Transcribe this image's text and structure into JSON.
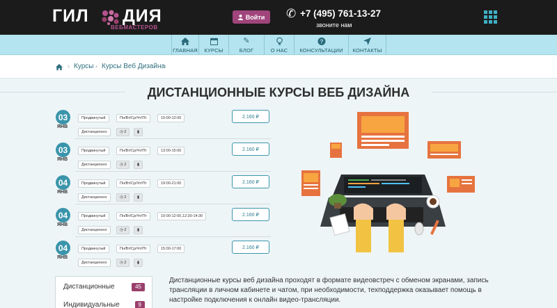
{
  "header": {
    "logo_left": "ГИЛ",
    "logo_right": "ДИЯ",
    "logo_sub": "ВЕБМАСТЕРОВ",
    "login_label": "Войти",
    "phone": "+7 (495) 761-13-27",
    "phone_note": "звоните нам"
  },
  "nav": [
    {
      "label": "ГЛАВНАЯ",
      "icon": "home-icon"
    },
    {
      "label": "КУРСЫ",
      "icon": "calendar-icon"
    },
    {
      "label": "БЛОГ",
      "icon": "pencil-icon"
    },
    {
      "label": "О НАС",
      "icon": "lightbulb-icon"
    },
    {
      "label": "КОНСУЛЬТАЦИИ",
      "icon": "question-icon"
    },
    {
      "label": "КОНТАКТЫ",
      "icon": "location-arrow-icon"
    }
  ],
  "breadcrumb": [
    "Курсы",
    "Курсы Веб Дизайна"
  ],
  "page_title": "ДИСТАНЦИОННЫЕ КУРСЫ ВЕБ ДИЗАЙНА",
  "courses": [
    {
      "day": "03",
      "month": "ЯНВ",
      "level": "Продвинутый",
      "days": "Пн/Вт/Ср/Чт/Пт",
      "time": "10:00-12:00",
      "format": "Дистанционно",
      "students": "2",
      "price": "2.160 ₽"
    },
    {
      "day": "03",
      "month": "ЯНВ",
      "level": "Продвинутый",
      "days": "Пн/Вт/Ср/Чт/Пт",
      "time": "13:00-15:00",
      "format": "Дистанционно",
      "students": "2",
      "price": "2.160 ₽"
    },
    {
      "day": "04",
      "month": "ЯНВ",
      "level": "Продвинутый",
      "days": "Пн/Вт/Ср/Чт/Пт",
      "time": "19:00-21:00",
      "format": "Дистанционно",
      "students": "2",
      "price": "2.160 ₽"
    },
    {
      "day": "04",
      "month": "ЯНВ",
      "level": "Продвинутый",
      "days": "Пн/Вт/Ср/Чт/Пт",
      "time": "10:00-12:00,12:30-14:30",
      "format": "Дистанционно",
      "students": "2",
      "price": "2.160 ₽"
    },
    {
      "day": "04",
      "month": "ЯНВ",
      "level": "Продвинутый",
      "days": "Пн/Вт/Ср/Чт/Пт",
      "time": "15:00-17:00",
      "format": "Дистанционно",
      "students": "2",
      "price": "2.160 ₽"
    }
  ],
  "filters": [
    {
      "label": "Дистанционные",
      "count": "45"
    },
    {
      "label": "Индивидуальные",
      "count": "9"
    }
  ],
  "description": "Дистанционные курсы веб дизайна проходят в формате видеовстреч с обменом экранами, запись трансляции в личном кабинете и чатом, при необходимости, техподдержка оказывает помощь в настройке подключения к онлайн видео-трансляции.",
  "colors": {
    "accent": "#3a95ab",
    "brand": "#a0457c",
    "nav_bg": "#b4e4ef",
    "topbar": "#1b1b1b"
  }
}
